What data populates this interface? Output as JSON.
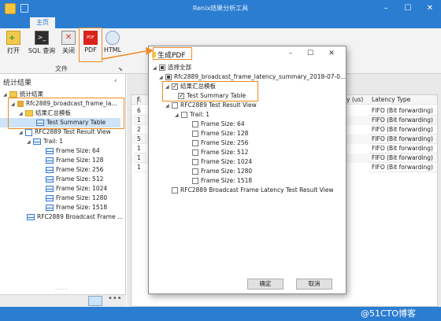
{
  "app": {
    "title": "Renix结果分析工具"
  },
  "ribbon": {
    "tab_main": "主页",
    "buttons": [
      {
        "label": "打开",
        "icon": "open-plus-icon"
      },
      {
        "label": "SQL 查询",
        "icon": "terminal-icon"
      },
      {
        "label": "关闭",
        "icon": "close-doc-icon"
      },
      {
        "label": "PDF",
        "icon": "pdf-icon"
      },
      {
        "label": "HTML",
        "icon": "html-icon"
      }
    ],
    "group_file": "文件"
  },
  "left_panel": {
    "title": "统计结果",
    "tree": [
      {
        "label": "统计结果",
        "level": 0,
        "icon": "folder"
      },
      {
        "label": "Rfc2889_broadcast_frame_la...",
        "level": 1,
        "icon": "db"
      },
      {
        "label": "结果汇总模板",
        "level": 2,
        "icon": "folder"
      },
      {
        "label": "Test Summary Table",
        "level": 3,
        "icon": "grid",
        "selected": true
      },
      {
        "label": "RFC2889 Test Result View",
        "level": 2,
        "icon": "doc"
      },
      {
        "label": "Trail: 1",
        "level": 3,
        "icon": "grid"
      },
      {
        "label": "Frame Size: 64",
        "level": 4,
        "icon": "grid"
      },
      {
        "label": "Frame Size: 128",
        "level": 4,
        "icon": "grid"
      },
      {
        "label": "Frame Size: 256",
        "level": 4,
        "icon": "grid"
      },
      {
        "label": "Frame Size: 512",
        "level": 4,
        "icon": "grid"
      },
      {
        "label": "Frame Size: 1024",
        "level": 4,
        "icon": "grid"
      },
      {
        "label": "Frame Size: 1280",
        "level": 4,
        "icon": "grid"
      },
      {
        "label": "Frame Size: 1518",
        "level": 4,
        "icon": "grid"
      },
      {
        "label": "RFC2889 Broadcast Frame ...",
        "level": 2,
        "icon": "grid"
      }
    ]
  },
  "table": {
    "col_partial": "y (us)",
    "col_latency_type": "Latency Type",
    "row_prefixes": [
      "6",
      "1",
      "2",
      "5",
      "1",
      "1",
      "1"
    ],
    "latency_values": [
      "FIFO (Bit forwarding)",
      "FIFO (Bit forwarding)",
      "FIFO (Bit forwarding)",
      "FIFO (Bit forwarding)",
      "FIFO (Bit forwarding)",
      "FIFO (Bit forwarding)",
      "FIFO (Bit forwarding)"
    ]
  },
  "dialog": {
    "title": "生成PDF",
    "select_all": "选择全部",
    "file_node": "Rfc2889_broadcast_frame_latency_summary_2018-07-0...",
    "summary_template": "结果汇总模板",
    "test_summary": "Test Summary Table",
    "result_view": "RFC2889 Test Result View",
    "trail": "Trail: 1",
    "frame_sizes": [
      "Frame Size: 64",
      "Frame Size: 128",
      "Frame Size: 256",
      "Frame Size: 512",
      "Frame Size: 1024",
      "Frame Size: 1280",
      "Frame Size: 1518"
    ],
    "broadcast_view": "RFC2889 Broadcast Frame Latency Test Result View",
    "ok": "确定",
    "cancel": "取消"
  },
  "watermark": "@51CTO博客",
  "colors": {
    "titlebar": "#2b7dd1",
    "highlight": "#f08a24"
  }
}
